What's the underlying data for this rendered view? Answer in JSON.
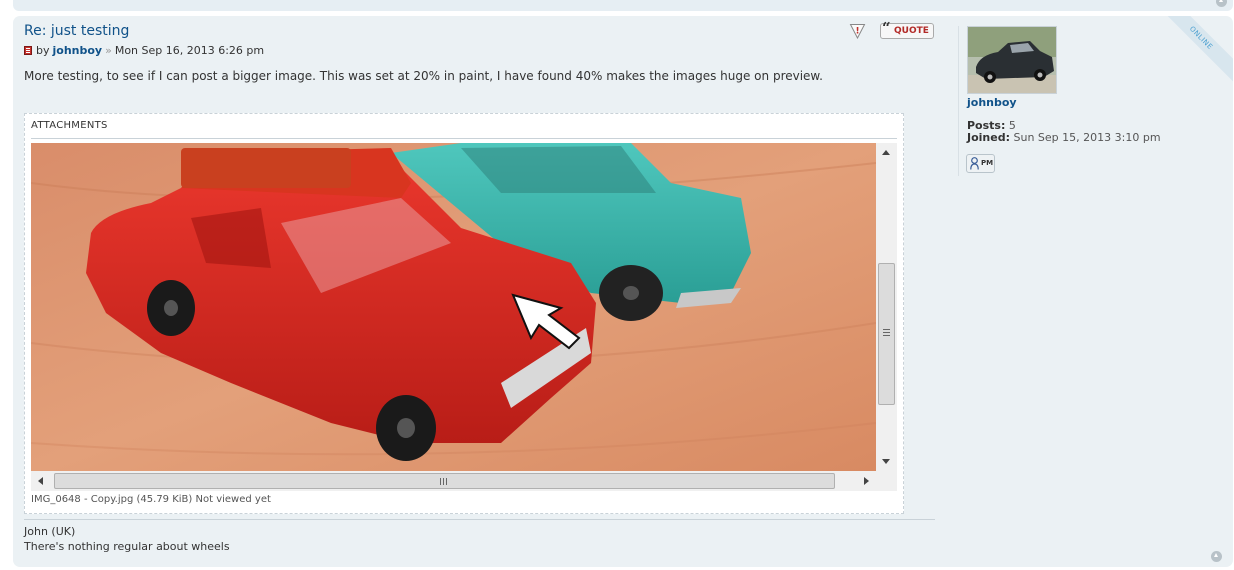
{
  "post": {
    "title": "Re: just testing",
    "by_label": "by",
    "author": "johnboy",
    "separator": "»",
    "date": "Mon Sep 16, 2013 6:26 pm",
    "content": "More testing, to see if I can post a bigger image. This was set at 20% in paint, I have found 40% makes the images huge on preview.",
    "actions": {
      "quote_label": "QUOTE",
      "quote_glyph": "“",
      "report_glyph": "!"
    }
  },
  "attachments": {
    "heading": "ATTACHMENTS",
    "file_info": "IMG_0648 - Copy.jpg (45.79 KiB) Not viewed yet"
  },
  "signature": {
    "line1": "John (UK)",
    "line2": "There's nothing regular about wheels"
  },
  "profile": {
    "online_label": "ONLINE",
    "username": "johnboy",
    "posts_label": "Posts:",
    "posts_value": "5",
    "joined_label": "Joined:",
    "joined_value": "Sun Sep 15, 2013 3:10 pm",
    "pm_label": "PM"
  },
  "colors": {
    "link": "#105289",
    "post_bg": "#ebf1f4",
    "quote_red": "#b22a27",
    "online_blue": "#4a9fd0"
  },
  "icons": {
    "post_icon": "post-icon",
    "report": "warning-icon",
    "quote": "quote-icon",
    "pm": "person-icon",
    "top": "arrow-up-icon"
  }
}
